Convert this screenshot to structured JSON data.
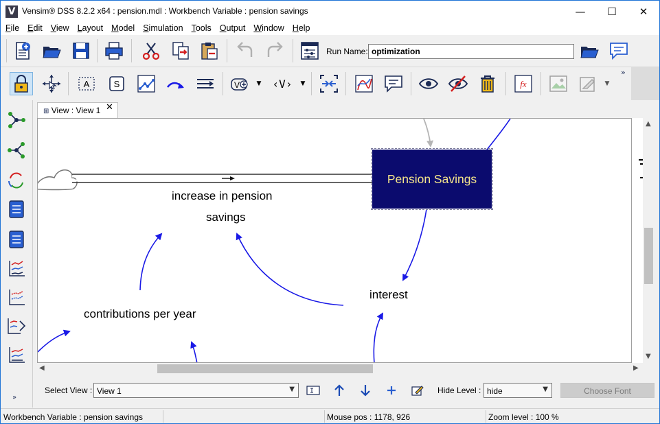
{
  "window": {
    "title": "Vensim® DSS 8.2.2 x64 : pension.mdl : Workbench Variable : pension savings",
    "app_icon": "V",
    "controls": {
      "minimize": "—",
      "maximize": "☐",
      "close": "✕"
    }
  },
  "menu": {
    "items": [
      {
        "u": "F",
        "rest": "ile"
      },
      {
        "u": "E",
        "rest": "dit"
      },
      {
        "u": "V",
        "rest": "iew"
      },
      {
        "u": "L",
        "rest": "ayout"
      },
      {
        "u": "M",
        "rest": "odel"
      },
      {
        "u": "S",
        "rest": "imulation"
      },
      {
        "u": "T",
        "rest": "ools"
      },
      {
        "u": "O",
        "rest": "utput"
      },
      {
        "u": "W",
        "rest": "indow"
      },
      {
        "u": "H",
        "rest": "elp"
      }
    ]
  },
  "toolbar1": {
    "run_name_label": "Run Name:",
    "run_name_value": "optimization",
    "icons": [
      "new-file-icon",
      "open-folder-icon",
      "save-icon",
      "print-icon",
      "cut-icon",
      "copy-icon",
      "paste-icon",
      "undo-icon",
      "redo-icon",
      "simulation-setup-icon",
      "browse-folder-icon",
      "chat-icon"
    ]
  },
  "toolbar2": {
    "icons": [
      "lock-icon",
      "move-pointer-icon",
      "variable-tool-icon",
      "stock-tool-icon",
      "arrow-tool-icon",
      "rate-tool-icon",
      "flow-tool-icon",
      "shadow-variable-icon",
      "model-variable-icon",
      "delete-icon",
      "graph-icon",
      "comment-icon",
      "show-icon",
      "hide-icon",
      "trash-icon",
      "equation-icon",
      "sketch-image-icon",
      "sketch-edit-icon"
    ],
    "label_A": "A",
    "label_S": "S",
    "label_V": "V",
    "label_angle_v": "‹V›",
    "overflow": "»"
  },
  "tab": {
    "label": "View : View 1",
    "close": "✕"
  },
  "diagram": {
    "stock_label": "Pension Savings",
    "flow_label_line1": "increase in pension",
    "flow_label_line2": "savings",
    "aux_interest": "interest",
    "aux_contributions": "contributions per year",
    "colors": {
      "stock_fill": "#0b0b6e",
      "stock_text": "#f5e58a",
      "link": "#1a1ae6",
      "ghost_link": "#b5b5b5"
    }
  },
  "viewbar": {
    "select_view_label": "Select View :",
    "select_view_value": "View 1",
    "hide_level_label": "Hide Level :",
    "hide_level_value": "hide",
    "choose_font_label": "Choose Font"
  },
  "status": {
    "left": "Workbench Variable : pension savings",
    "mouse_pos": "Mouse pos : 1178, 926",
    "zoom": "Zoom level : 100 %"
  }
}
